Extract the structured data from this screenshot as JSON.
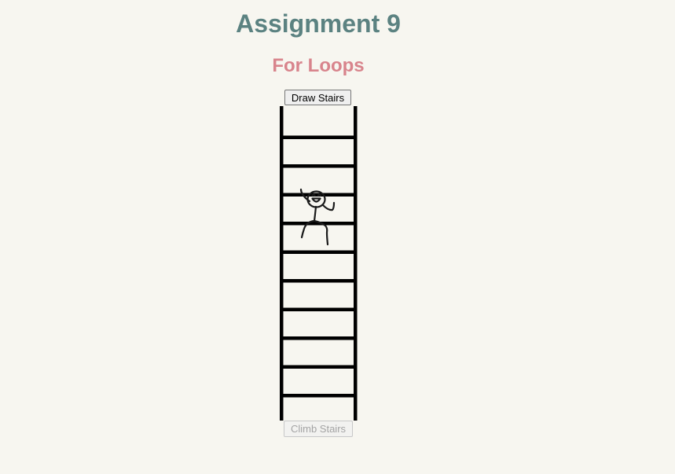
{
  "header": {
    "title": "Assignment 9",
    "subtitle": "For Loops"
  },
  "controls": {
    "draw_label": "Draw Stairs",
    "climb_label": "Climb Stairs",
    "climb_disabled": true
  },
  "ladder": {
    "rung_count": 10,
    "rail_color": "#000000"
  },
  "climber": {
    "icon": "stick-figure-icon"
  }
}
